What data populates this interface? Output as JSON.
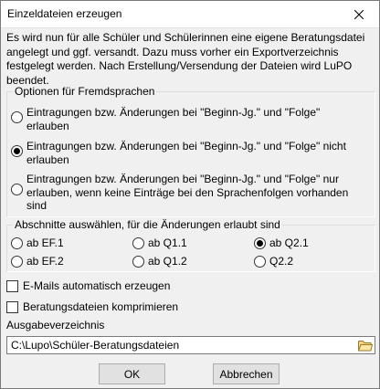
{
  "window": {
    "title": "Einzeldateien erzeugen"
  },
  "intro_text": "Es wird nun für alle Schüler und Schülerinnen eine eigene Beratungsdatei angelegt und ggf. versandt. Dazu muss vorher ein Exportverzeichnis festgelegt werden. Nach Erstellung/Versendung der Dateien wird LuPO beendet.",
  "language_options": {
    "title": "Optionen für Fremdsprachen",
    "options": [
      {
        "label": "Eintragungen bzw. Änderungen bei \"Beginn-Jg.\" und \"Folge\" erlauben",
        "checked": false
      },
      {
        "label": "Eintragungen bzw. Änderungen bei \"Beginn-Jg.\" und \"Folge\" nicht erlauben",
        "checked": true
      },
      {
        "label": "Eintragungen bzw. Änderungen bei \"Beginn-Jg.\" und \"Folge\" nur erlauben, wenn keine Einträge bei den Sprachenfolgen vorhanden sind",
        "checked": false
      }
    ]
  },
  "sections": {
    "title": "Abschnitte auswählen, für die Änderungen erlaubt sind",
    "options": [
      {
        "label": "ab EF.1",
        "checked": false
      },
      {
        "label": "ab Q1.1",
        "checked": false
      },
      {
        "label": "ab Q2.1",
        "checked": true
      },
      {
        "label": "ab EF.2",
        "checked": false
      },
      {
        "label": "ab Q1.2",
        "checked": false
      },
      {
        "label": "Q2.2",
        "checked": false
      }
    ]
  },
  "checkboxes": {
    "emails": {
      "label": "E-Mails automatisch erzeugen",
      "checked": false
    },
    "compress": {
      "label": "Beratungsdateien komprimieren",
      "checked": false
    }
  },
  "output": {
    "label": "Ausgabeverzeichnis",
    "path": "C:\\Lupo\\Schüler-Beratungsdateien"
  },
  "buttons": {
    "ok": "OK",
    "cancel": "Abbrechen"
  },
  "icons": {
    "close": "close-icon",
    "folder": "folder-icon"
  }
}
